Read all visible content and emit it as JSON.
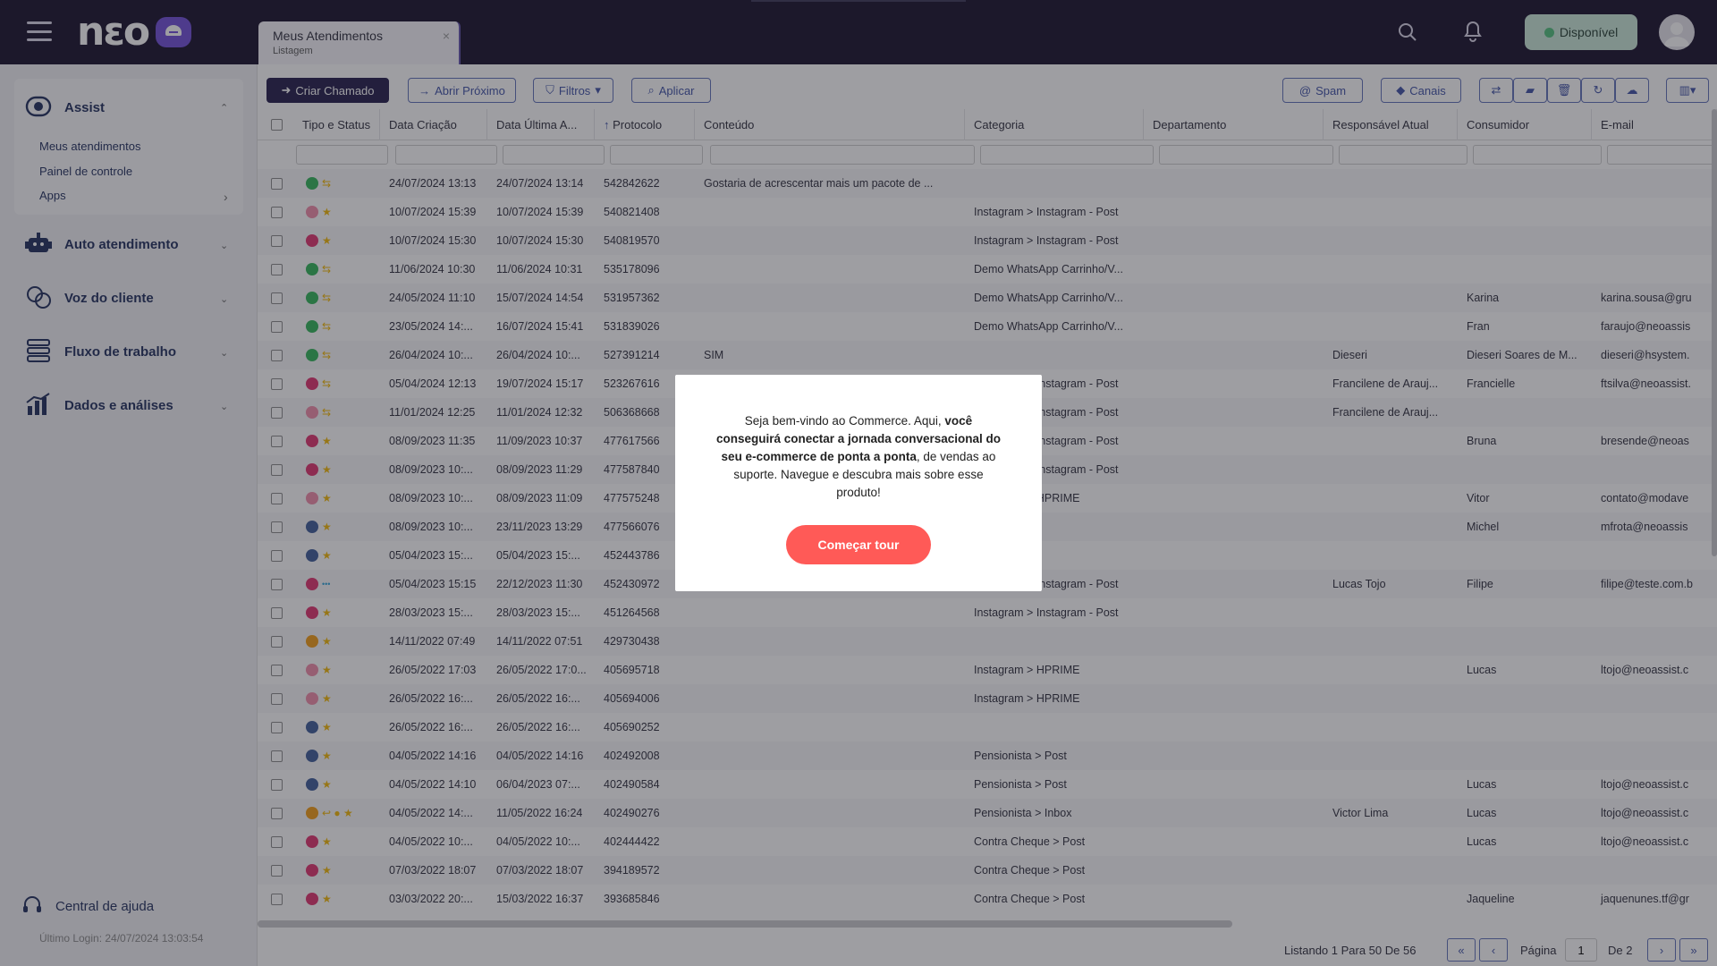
{
  "header": {
    "logo_text": "nεo",
    "tab": {
      "title": "Meus Atendimentos",
      "subtitle": "Listagem",
      "close": "×"
    },
    "status_label": "Disponível"
  },
  "sidebar": {
    "sections": [
      {
        "label": "Assist",
        "icon": "assist-icon"
      },
      {
        "label": "Auto atendimento",
        "icon": "robot-icon"
      },
      {
        "label": "Voz do cliente",
        "icon": "faces-icon"
      },
      {
        "label": "Fluxo de trabalho",
        "icon": "workflow-icon"
      },
      {
        "label": "Dados e análises",
        "icon": "analytics-icon"
      }
    ],
    "assist_items": [
      "Meus atendimentos",
      "Painel de controle",
      "Apps"
    ],
    "help_label": "Central de ajuda",
    "last_login": "Último Login: 24/07/2024 13:03:54"
  },
  "toolbar": {
    "create": "Criar Chamado",
    "open_next": "Abrir Próximo",
    "filters": "Filtros",
    "apply": "Aplicar",
    "spam": "Spam",
    "channels": "Canais"
  },
  "table": {
    "columns": [
      "Tipo e Status",
      "Data Criação",
      "Data Última A...",
      "Protocolo",
      "Conteúdo",
      "Categoria",
      "Departamento",
      "Responsável Atual",
      "Consumidor",
      "E-mail"
    ],
    "rows": [
      {
        "channel": "whatsapp",
        "status": "transfer",
        "created": "24/07/2024 13:13",
        "last": "24/07/2024 13:14",
        "protocol": "542842622",
        "content": "Gostaria de acrescentar mais um pacote de ...",
        "category": "",
        "resp": "",
        "consumer": "",
        "email": ""
      },
      {
        "channel": "instagram-light",
        "status": "star",
        "created": "10/07/2024 15:39",
        "last": "10/07/2024 15:39",
        "protocol": "540821408",
        "content": "",
        "category": "Instagram > Instagram - Post",
        "resp": "",
        "consumer": "",
        "email": ""
      },
      {
        "channel": "instagram",
        "status": "star",
        "created": "10/07/2024 15:30",
        "last": "10/07/2024 15:30",
        "protocol": "540819570",
        "content": "",
        "category": "Instagram > Instagram - Post",
        "resp": "",
        "consumer": "",
        "email": ""
      },
      {
        "channel": "whatsapp",
        "status": "transfer",
        "created": "11/06/2024 10:30",
        "last": "11/06/2024 10:31",
        "protocol": "535178096",
        "content": "",
        "category": "Demo WhatsApp Carrinho/V...",
        "resp": "",
        "consumer": "",
        "email": ""
      },
      {
        "channel": "whatsapp",
        "status": "transfer",
        "created": "24/05/2024 11:10",
        "last": "15/07/2024 14:54",
        "protocol": "531957362",
        "content": "",
        "category": "Demo WhatsApp Carrinho/V...",
        "resp": "",
        "consumer": "Karina",
        "email": "karina.sousa@gru"
      },
      {
        "channel": "whatsapp",
        "status": "transfer",
        "created": "23/05/2024 14:...",
        "last": "16/07/2024 15:41",
        "protocol": "531839026",
        "content": "",
        "category": "Demo WhatsApp Carrinho/V...",
        "resp": "",
        "consumer": "Fran",
        "email": "faraujo@neoassis"
      },
      {
        "channel": "whatsapp",
        "status": "transfer",
        "created": "26/04/2024 10:...",
        "last": "26/04/2024 10:...",
        "protocol": "527391214",
        "content": "SIM",
        "category": "",
        "resp": "Dieseri",
        "consumer": "Dieseri Soares de M...",
        "email": "dieseri@hsystem."
      },
      {
        "channel": "instagram",
        "status": "transfer",
        "created": "05/04/2024 12:13",
        "last": "19/07/2024 15:17",
        "protocol": "523267616",
        "content": "",
        "category": "Instagram > Instagram - Post",
        "resp": "Francilene de Arauj...",
        "consumer": "Francielle",
        "email": "ftsilva@neoassist."
      },
      {
        "channel": "instagram-light",
        "status": "transfer",
        "created": "11/01/2024 12:25",
        "last": "11/01/2024 12:32",
        "protocol": "506368668",
        "content": "",
        "category": "Instagram > Instagram - Post",
        "resp": "Francilene de Arauj...",
        "consumer": "",
        "email": ""
      },
      {
        "channel": "instagram",
        "status": "star",
        "created": "08/09/2023 11:35",
        "last": "11/09/2023 10:37",
        "protocol": "477617566",
        "content": "",
        "category": "Instagram > Instagram - Post",
        "resp": "",
        "consumer": "Bruna",
        "email": "bresende@neoas"
      },
      {
        "channel": "instagram",
        "status": "star",
        "created": "08/09/2023 10:...",
        "last": "08/09/2023 11:29",
        "protocol": "477587840",
        "content": "",
        "category": "Instagram > Instagram - Post",
        "resp": "",
        "consumer": "",
        "email": ""
      },
      {
        "channel": "instagram-light",
        "status": "star",
        "created": "08/09/2023 10:...",
        "last": "08/09/2023 11:09",
        "protocol": "477575248",
        "content": "",
        "category": "Instagram > HPRIME",
        "resp": "",
        "consumer": "Vitor",
        "email": "contato@modave"
      },
      {
        "channel": "facebook",
        "status": "star",
        "created": "08/09/2023 10:...",
        "last": "23/11/2023 13:29",
        "protocol": "477566076",
        "content": "",
        "category": "",
        "resp": "",
        "consumer": "Michel",
        "email": "mfrota@neoassis"
      },
      {
        "channel": "facebook",
        "status": "star",
        "created": "05/04/2023 15:...",
        "last": "05/04/2023 15:...",
        "protocol": "452443786",
        "content": "",
        "category": "",
        "resp": "",
        "consumer": "",
        "email": ""
      },
      {
        "channel": "instagram",
        "status": "dots",
        "created": "05/04/2023 15:15",
        "last": "22/12/2023 11:30",
        "protocol": "452430972",
        "content": "",
        "category": "Instagram > Instagram - Post",
        "resp": "Lucas Tojo",
        "consumer": "Filipe",
        "email": "filipe@teste.com.b"
      },
      {
        "channel": "instagram",
        "status": "star",
        "created": "28/03/2023 15:...",
        "last": "28/03/2023 15:...",
        "protocol": "451264568",
        "content": "",
        "category": "Instagram > Instagram - Post",
        "resp": "",
        "consumer": "",
        "email": ""
      },
      {
        "channel": "orange",
        "status": "star",
        "created": "14/11/2022 07:49",
        "last": "14/11/2022 07:51",
        "protocol": "429730438",
        "content": "",
        "category": "",
        "resp": "",
        "consumer": "",
        "email": ""
      },
      {
        "channel": "instagram-light",
        "status": "star",
        "created": "26/05/2022 17:03",
        "last": "26/05/2022 17:0...",
        "protocol": "405695718",
        "content": "",
        "category": "Instagram > HPRIME",
        "resp": "",
        "consumer": "Lucas",
        "email": "ltojo@neoassist.c"
      },
      {
        "channel": "instagram-light",
        "status": "star",
        "created": "26/05/2022 16:...",
        "last": "26/05/2022 16:...",
        "protocol": "405694006",
        "content": "",
        "category": "Instagram > HPRIME",
        "resp": "",
        "consumer": "",
        "email": ""
      },
      {
        "channel": "facebook",
        "status": "star",
        "created": "26/05/2022 16:...",
        "last": "26/05/2022 16:...",
        "protocol": "405690252",
        "content": "",
        "category": "",
        "resp": "",
        "consumer": "",
        "email": ""
      },
      {
        "channel": "facebook",
        "status": "star",
        "created": "04/05/2022 14:16",
        "last": "04/05/2022 14:16",
        "protocol": "402492008",
        "content": "",
        "category": "Pensionista > Post",
        "resp": "",
        "consumer": "",
        "email": ""
      },
      {
        "channel": "facebook",
        "status": "star",
        "created": "04/05/2022 14:10",
        "last": "06/04/2023 07:...",
        "protocol": "402490584",
        "content": "",
        "category": "Pensionista > Post",
        "resp": "",
        "consumer": "Lucas",
        "email": "ltojo@neoassist.c"
      },
      {
        "channel": "orange",
        "status": "multi",
        "created": "04/05/2022 14:...",
        "last": "11/05/2022 16:24",
        "protocol": "402490276",
        "content": "",
        "category": "Pensionista > Inbox",
        "resp": "Victor Lima",
        "consumer": "Lucas",
        "email": "ltojo@neoassist.c"
      },
      {
        "channel": "instagram",
        "status": "star",
        "created": "04/05/2022 10:...",
        "last": "04/05/2022 10:...",
        "protocol": "402444422",
        "content": "",
        "category": "Contra Cheque > Post",
        "resp": "",
        "consumer": "Lucas",
        "email": "ltojo@neoassist.c"
      },
      {
        "channel": "instagram",
        "status": "star",
        "created": "07/03/2022 18:07",
        "last": "07/03/2022 18:07",
        "protocol": "394189572",
        "content": "",
        "category": "Contra Cheque > Post",
        "resp": "",
        "consumer": "",
        "email": ""
      },
      {
        "channel": "instagram",
        "status": "star",
        "created": "03/03/2022 20:...",
        "last": "15/03/2022 16:37",
        "protocol": "393685846",
        "content": "",
        "category": "Contra Cheque > Post",
        "resp": "",
        "consumer": "Jaqueline",
        "email": "jaquenunes.tf@gr"
      }
    ]
  },
  "pager": {
    "summary": "Listando 1 Para 50 De 56",
    "page_label": "Página",
    "page_value": "1",
    "of_label": "De 2"
  },
  "modal": {
    "text_before": "Seja bem-vindo ao Commerce. Aqui, ",
    "text_bold": "você conseguirá conectar a jornada conversacional do seu e-commerce de ponta a ponta",
    "text_after": ", de vendas ao suporte. Navegue e descubra mais sobre esse produto!",
    "button": "Começar tour"
  },
  "colors": {
    "topbar": "#130b27",
    "primary_button": "#1f1848",
    "accent_outline": "#5e6fb8",
    "tour_button": "#ff5a57",
    "status_bg": "#c9e7d8"
  }
}
